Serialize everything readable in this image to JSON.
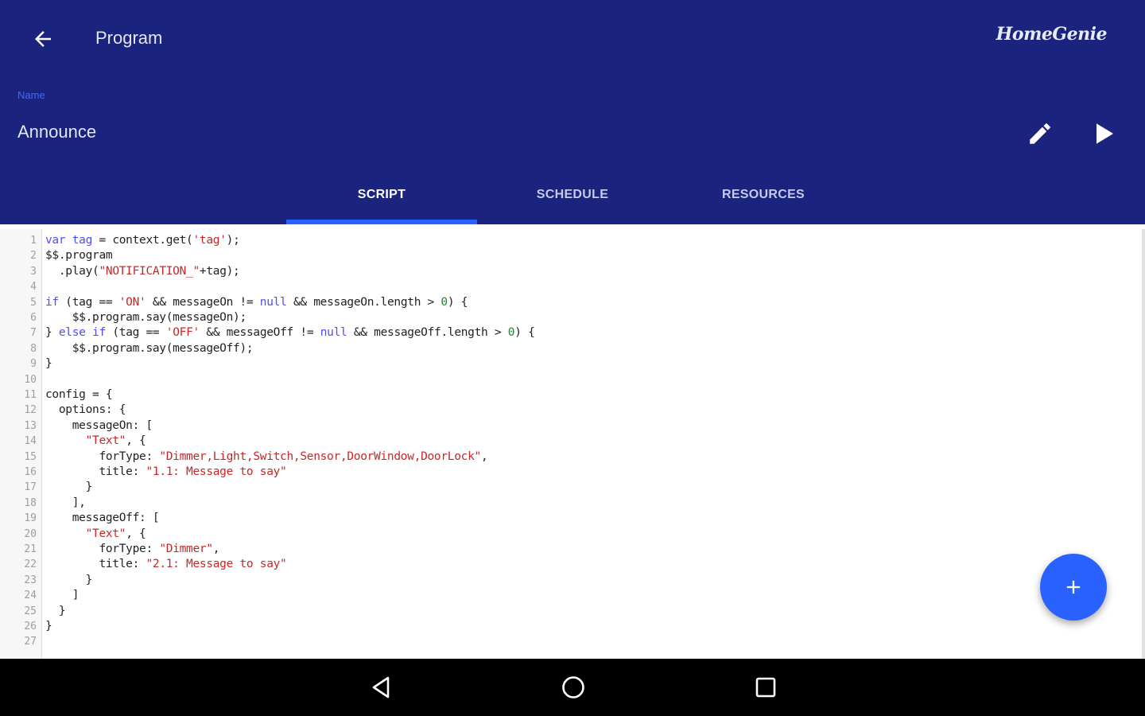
{
  "header": {
    "title": "Program",
    "brand": "HomeGenie",
    "back_icon": "arrow-back-icon",
    "edit_icon": "pencil-icon",
    "run_icon": "play-icon",
    "background_color": "#1a237e",
    "accent_color": "#2962ff"
  },
  "program": {
    "name_label": "Name",
    "name": "Announce"
  },
  "tabs": [
    {
      "label": "SCRIPT",
      "active": true
    },
    {
      "label": "SCHEDULE",
      "active": false
    },
    {
      "label": "RESOURCES",
      "active": false
    }
  ],
  "editor": {
    "lines": [
      [
        [
          "var",
          "keyword"
        ],
        [
          " ",
          "plain"
        ],
        [
          "tag",
          "variable"
        ],
        [
          " = context.get(",
          "plain"
        ],
        [
          "'tag'",
          "string"
        ],
        [
          ");",
          "plain"
        ]
      ],
      [
        [
          "$$.program",
          "plain"
        ]
      ],
      [
        [
          "  .play(",
          "plain"
        ],
        [
          "\"NOTIFICATION_\"",
          "string"
        ],
        [
          "+tag);",
          "plain"
        ]
      ],
      [],
      [
        [
          "if",
          "keyword"
        ],
        [
          " (tag == ",
          "plain"
        ],
        [
          "'ON'",
          "string"
        ],
        [
          " && messageOn != ",
          "plain"
        ],
        [
          "null",
          "keyword"
        ],
        [
          " && messageOn.length > ",
          "plain"
        ],
        [
          "0",
          "number"
        ],
        [
          ") {",
          "plain"
        ]
      ],
      [
        [
          "    $$.program.say(messageOn);",
          "plain"
        ]
      ],
      [
        [
          "} ",
          "plain"
        ],
        [
          "else",
          "keyword"
        ],
        [
          " ",
          "plain"
        ],
        [
          "if",
          "keyword"
        ],
        [
          " (tag == ",
          "plain"
        ],
        [
          "'OFF'",
          "string"
        ],
        [
          " && messageOff != ",
          "plain"
        ],
        [
          "null",
          "keyword"
        ],
        [
          " && messageOff.length > ",
          "plain"
        ],
        [
          "0",
          "number"
        ],
        [
          ") {",
          "plain"
        ]
      ],
      [
        [
          "    $$.program.say(messageOff);",
          "plain"
        ]
      ],
      [
        [
          "}",
          "plain"
        ]
      ],
      [],
      [
        [
          "config = {",
          "plain"
        ]
      ],
      [
        [
          "  options: {",
          "plain"
        ]
      ],
      [
        [
          "    messageOn: [",
          "plain"
        ]
      ],
      [
        [
          "      ",
          "plain"
        ],
        [
          "\"Text\"",
          "string"
        ],
        [
          ", {",
          "plain"
        ]
      ],
      [
        [
          "        forType: ",
          "plain"
        ],
        [
          "\"Dimmer,Light,Switch,Sensor,DoorWindow,DoorLock\"",
          "string"
        ],
        [
          ",",
          "plain"
        ]
      ],
      [
        [
          "        title: ",
          "plain"
        ],
        [
          "\"1.1: Message to say\"",
          "string"
        ]
      ],
      [
        [
          "      }",
          "plain"
        ]
      ],
      [
        [
          "    ],",
          "plain"
        ]
      ],
      [
        [
          "    messageOff: [",
          "plain"
        ]
      ],
      [
        [
          "      ",
          "plain"
        ],
        [
          "\"Text\"",
          "string"
        ],
        [
          ", {",
          "plain"
        ]
      ],
      [
        [
          "        forType: ",
          "plain"
        ],
        [
          "\"Dimmer\"",
          "string"
        ],
        [
          ",",
          "plain"
        ]
      ],
      [
        [
          "        title: ",
          "plain"
        ],
        [
          "\"2.1: Message to say\"",
          "string"
        ]
      ],
      [
        [
          "      }",
          "plain"
        ]
      ],
      [
        [
          "    ]",
          "plain"
        ]
      ],
      [
        [
          "  }",
          "plain"
        ]
      ],
      [
        [
          "}",
          "plain"
        ]
      ],
      []
    ]
  },
  "fab": {
    "icon": "plus-icon",
    "label": "+"
  },
  "navbar": {
    "back_icon": "nav-back-icon",
    "home_icon": "nav-home-icon",
    "recents_icon": "nav-recents-icon"
  }
}
